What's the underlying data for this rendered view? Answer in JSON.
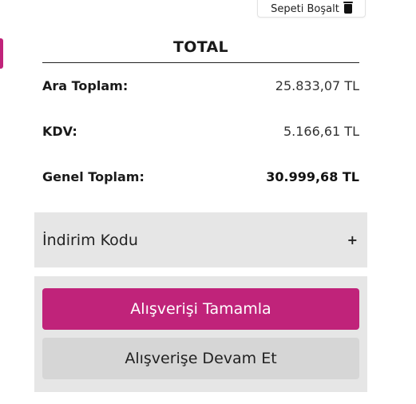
{
  "header": {
    "empty_cart_label": "Sepeti Boşalt",
    "empty_cart_icon": "trash-icon"
  },
  "summary": {
    "title": "TOTAL",
    "rows": [
      {
        "label": "Ara Toplam:",
        "value": "25.833,07 TL"
      },
      {
        "label": "KDV:",
        "value": "5.166,61 TL"
      },
      {
        "label": "Genel Toplam:",
        "value": "30.999,68 TL"
      }
    ]
  },
  "coupon": {
    "label": "İndirim Kodu",
    "toggle": "+"
  },
  "actions": {
    "checkout_label": "Alışverişi Tamamla",
    "continue_label": "Alışverişe Devam Et"
  },
  "colors": {
    "accent": "#c0237a",
    "panel_bg": "#e6e6e6",
    "secondary_btn": "#d6d6d6"
  }
}
